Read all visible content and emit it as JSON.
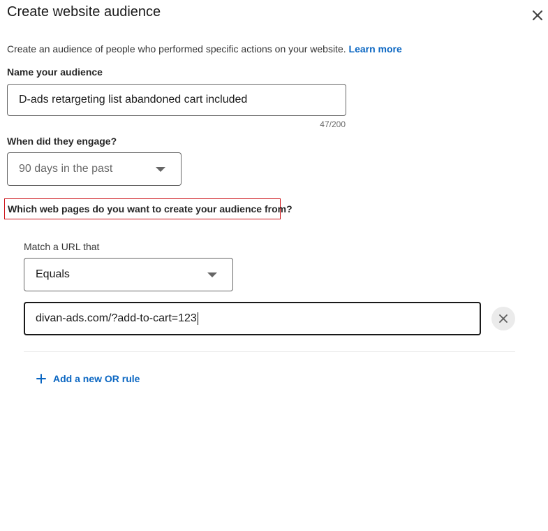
{
  "modal": {
    "title": "Create website audience",
    "description": "Create an audience of people who performed specific actions on your website.",
    "learn_more": "Learn more"
  },
  "name_field": {
    "label": "Name your audience",
    "value": "D-ads retargeting list abandoned cart included",
    "counter": "47/200"
  },
  "engage_field": {
    "label": "When did they engage?",
    "selected": "90 days in the past"
  },
  "pages_question": "Which web pages do you want to create your audience from?",
  "url_rule": {
    "label": "Match a URL that",
    "match_type": "Equals",
    "url_value": "divan-ads.com/?add-to-cart=123"
  },
  "add_rule_label": "Add a new OR rule",
  "colors": {
    "link": "#0a66c2",
    "highlight_border": "#cc1016"
  },
  "icons": {
    "close": "close-icon",
    "dropdown": "caret-down-icon",
    "remove": "remove-icon",
    "add": "plus-icon"
  }
}
